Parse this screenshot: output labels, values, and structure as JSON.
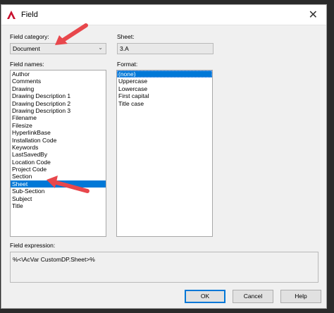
{
  "window": {
    "title": "Field"
  },
  "field_category": {
    "label": "Field category:",
    "value": "Document"
  },
  "sheet": {
    "label": "Sheet:",
    "value": "3.A"
  },
  "field_names": {
    "label": "Field names:",
    "items": [
      "Author",
      "Comments",
      "Drawing",
      "Drawing Description 1",
      "Drawing Description 2",
      "Drawing Description 3",
      "Filename",
      "Filesize",
      "HyperlinkBase",
      "Installation Code",
      "Keywords",
      "LastSavedBy",
      "Location Code",
      "Project Code",
      "Section",
      "Sheet",
      "Sub-Section",
      "Subject",
      "Title"
    ],
    "selected": "Sheet"
  },
  "format": {
    "label": "Format:",
    "items": [
      "(none)",
      "Uppercase",
      "Lowercase",
      "First capital",
      "Title case"
    ],
    "selected": "(none)"
  },
  "field_expression": {
    "label": "Field expression:",
    "value": "%<\\AcVar CustomDP.Sheet>%"
  },
  "buttons": {
    "ok": "OK",
    "cancel": "Cancel",
    "help": "Help"
  },
  "colors": {
    "accent": "#0078d7",
    "annotation_arrow": "#e8474c",
    "app_icon": "#c8102e"
  }
}
